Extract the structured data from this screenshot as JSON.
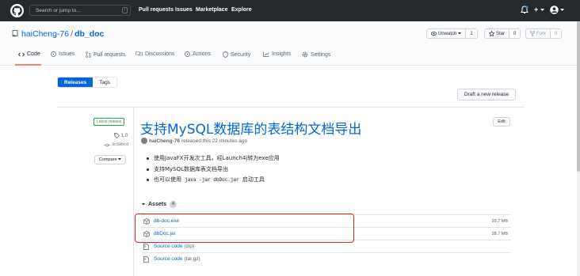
{
  "header": {
    "search_placeholder": "Search or jump to...",
    "search_shortcut": "/",
    "nav": [
      "Pull requests",
      "Issues",
      "Marketplace",
      "Explore"
    ],
    "plus_label": "+"
  },
  "repo": {
    "owner": "haiCheng-76",
    "separator": "/",
    "name": "db_doc",
    "watch_label": "Unwatch",
    "watch_count": "1",
    "star_label": "Star",
    "star_count": "0",
    "fork_label": "Fork",
    "fork_count": "0"
  },
  "tabs": [
    {
      "label": "Code",
      "icon": "code-icon"
    },
    {
      "label": "Issues",
      "icon": "issue-icon"
    },
    {
      "label": "Pull requests",
      "icon": "pull-request-icon"
    },
    {
      "label": "Discussions",
      "icon": "discussion-icon"
    },
    {
      "label": "Actions",
      "icon": "play-icon"
    },
    {
      "label": "Security",
      "icon": "shield-icon"
    },
    {
      "label": "Insights",
      "icon": "graph-icon"
    },
    {
      "label": "Settings",
      "icon": "gear-icon"
    }
  ],
  "subnav": {
    "releases": "Releases",
    "tags": "Tags"
  },
  "draft_button": "Draft a new release",
  "release": {
    "badge": "Latest release",
    "tag": "1.0",
    "commit": "3c50bcd",
    "compare_label": "Compare",
    "edit_label": "Edit",
    "title": "支持MySQL数据库的表结构文档导出",
    "author": "haiCheng-76",
    "meta_text": "released this 22 minutes ago",
    "notes": [
      {
        "text": "使用JavaFX开发次工具，经Launch4j转为exe应用"
      },
      {
        "text": "支持MySQL数据库表文档导出"
      },
      {
        "pre": "也可以使用 ",
        "code": "java -jar dbDoc.jar",
        "post": " 启动工具"
      }
    ],
    "assets_label": "Assets",
    "assets_count": "4",
    "assets": [
      {
        "name": "db-doc.exe",
        "size": "39.7 MB",
        "icon": "package-icon"
      },
      {
        "name": "dbDoc.jar",
        "size": "38.7 MB",
        "icon": "package-icon"
      },
      {
        "name": "Source code",
        "suffix": "(zip)",
        "icon": "file-zip-icon"
      },
      {
        "name": "Source code",
        "suffix": "(tar.gz)",
        "icon": "file-zip-icon"
      }
    ]
  },
  "colors": {
    "header_bg": "#24292e",
    "link": "#0366d6",
    "active_tab_underline": "#f9826c",
    "latest_badge": "#28a745",
    "highlight_box": "#e0252e"
  }
}
